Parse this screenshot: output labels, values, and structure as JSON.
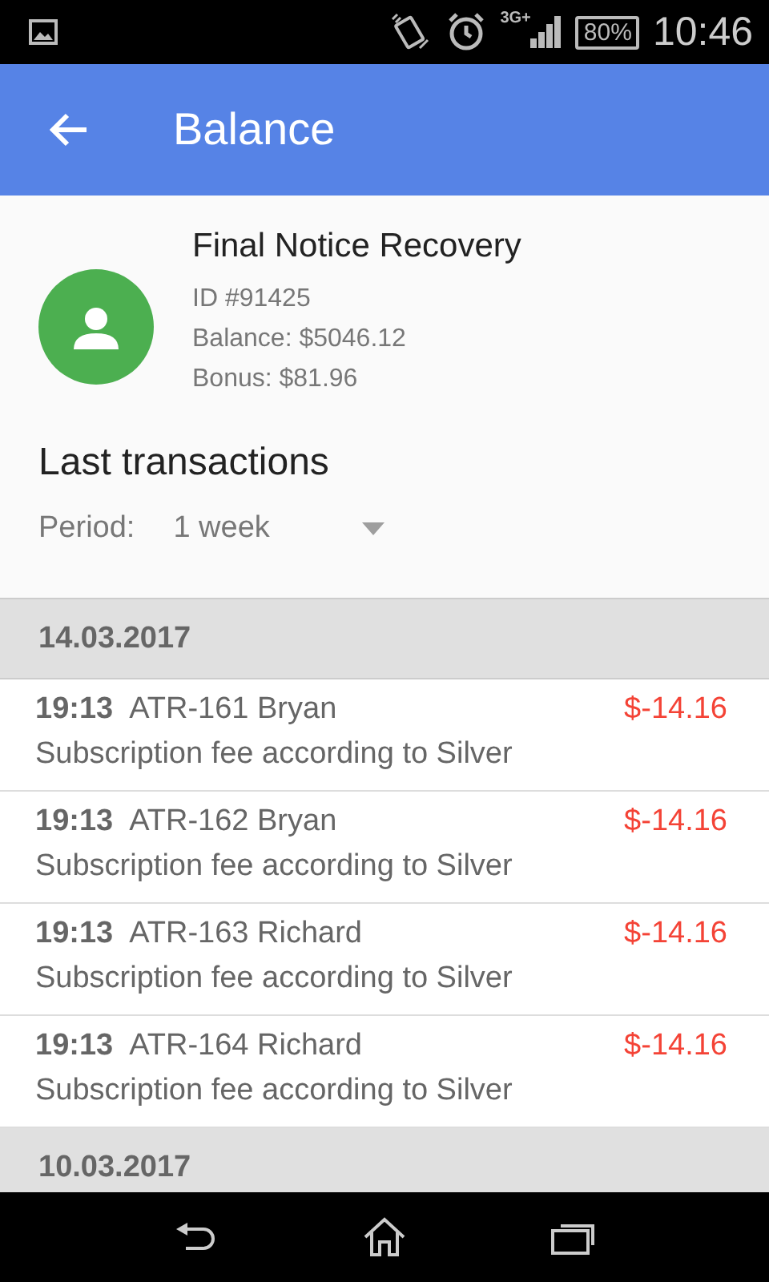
{
  "status_bar": {
    "network": "3G+",
    "battery": "80%",
    "time": "10:46"
  },
  "app_bar": {
    "title": "Balance"
  },
  "account": {
    "name": "Final Notice Recovery",
    "id": "ID #91425",
    "balance": "Balance: $5046.12",
    "bonus": "Bonus: $81.96"
  },
  "section_title": "Last transactions",
  "period": {
    "label": "Period:",
    "value": "1 week"
  },
  "groups": [
    {
      "date": "14.03.2017",
      "transactions": [
        {
          "time": "19:13",
          "title": "ATR-161 Bryan",
          "amount": "$-14.16",
          "description": "Subscription fee according to Silver"
        },
        {
          "time": "19:13",
          "title": "ATR-162 Bryan",
          "amount": "$-14.16",
          "description": "Subscription fee according to Silver"
        },
        {
          "time": "19:13",
          "title": "ATR-163 Richard",
          "amount": "$-14.16",
          "description": "Subscription fee according to Silver"
        },
        {
          "time": "19:13",
          "title": "ATR-164 Richard",
          "amount": "$-14.16",
          "description": "Subscription fee according to Silver"
        }
      ]
    },
    {
      "date": "10.03.2017"
    }
  ]
}
